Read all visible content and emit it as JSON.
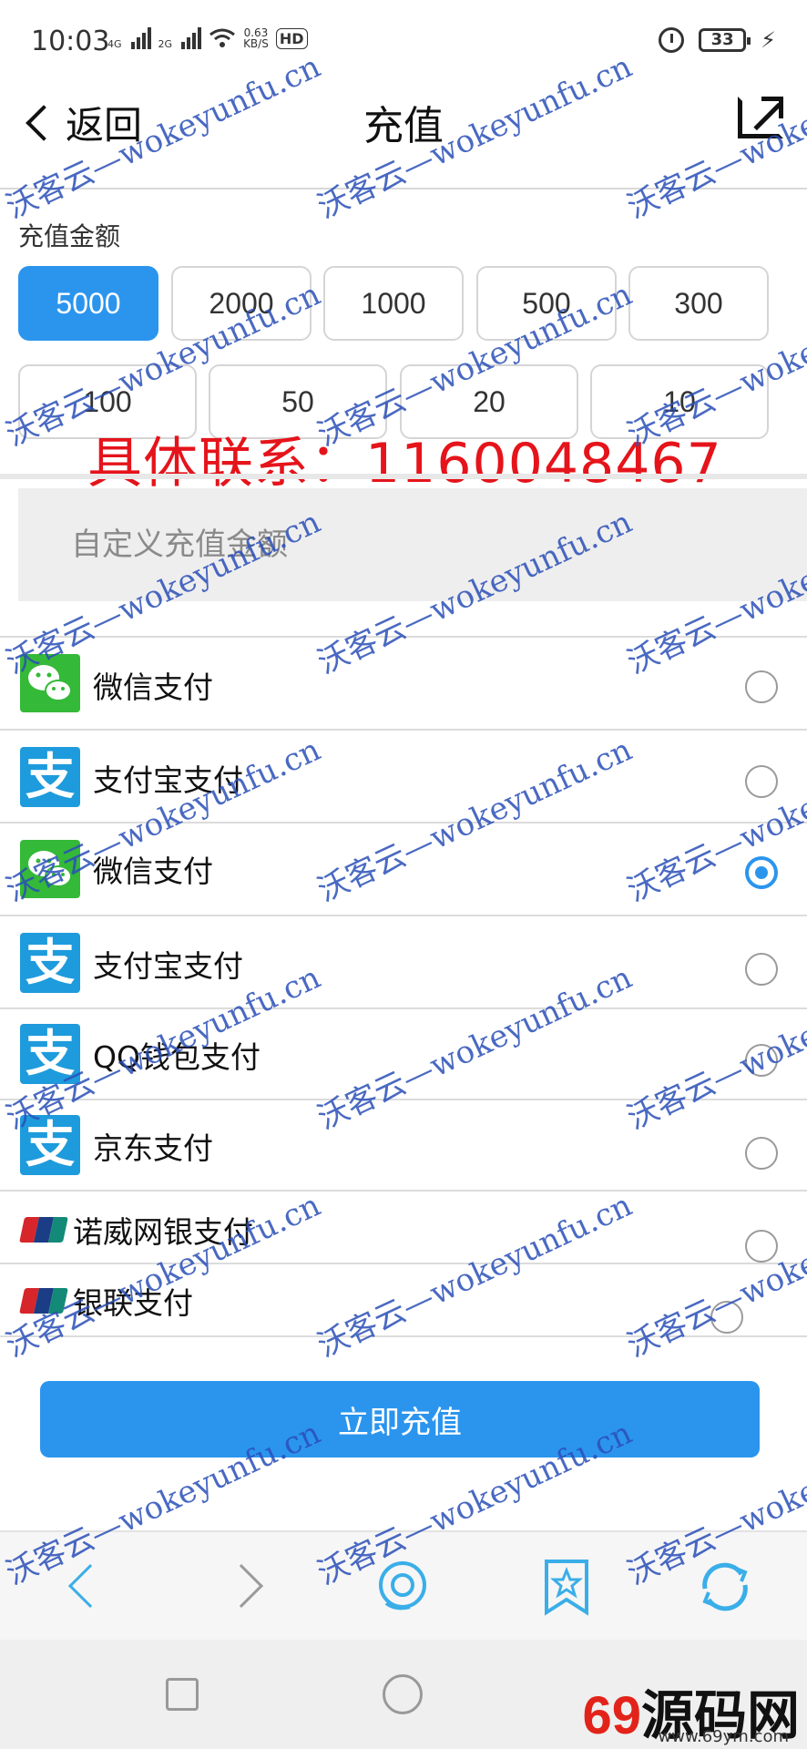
{
  "status_bar": {
    "time": "10:03",
    "net1": "4G",
    "net2": "2G",
    "speed_value": "0.63",
    "speed_unit": "KB/S",
    "hd": "HD",
    "battery": "33"
  },
  "nav": {
    "back_label": "返回",
    "title": "充值"
  },
  "amount_section": {
    "label": "充值金额",
    "amounts": [
      "5000",
      "2000",
      "1000",
      "500",
      "300",
      "100",
      "50",
      "20",
      "10"
    ],
    "selected": "5000"
  },
  "contact_banner": "具体联系：1160048467",
  "custom_amount": {
    "placeholder": "自定义充值金额"
  },
  "payment_methods": [
    {
      "label": "微信支付",
      "icon": "wechat-icon",
      "selected": false
    },
    {
      "label": "支付宝支付",
      "icon": "alipay-icon",
      "selected": false
    },
    {
      "label": "微信支付",
      "icon": "wechat-icon",
      "selected": true
    },
    {
      "label": "支付宝支付",
      "icon": "alipay-icon",
      "selected": false
    },
    {
      "label": "QQ钱包支付",
      "icon": "alipay-icon",
      "selected": false
    },
    {
      "label": "京东支付",
      "icon": "alipay-icon",
      "selected": false
    },
    {
      "label": "诺威网银支付",
      "icon": "unionpay-icon",
      "selected": false
    },
    {
      "label": "银联支付",
      "icon": "unionpay-icon",
      "selected": false
    }
  ],
  "alipay_glyph": "支",
  "submit_label": "立即充值",
  "watermark_text": "沃客云—wokeyunfu.cn",
  "brand": {
    "logo_num": "69",
    "logo_text": "源码网",
    "url": "www.69ym.com"
  },
  "colors": {
    "accent": "#2b95ee",
    "wechat": "#35b938",
    "alipay": "#1e9bdc",
    "contact_red": "#e5141b",
    "watermark": "#2a4fb8"
  }
}
